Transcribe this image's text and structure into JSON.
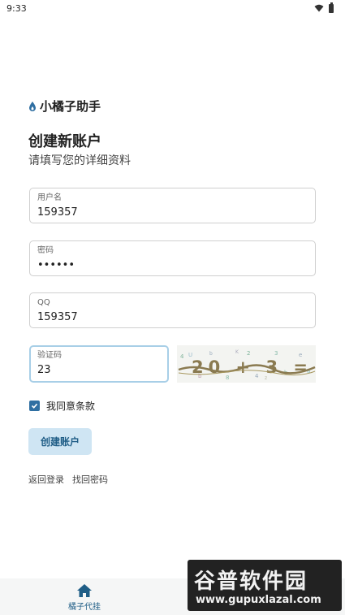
{
  "status_bar": {
    "time": "9:33"
  },
  "brand": {
    "title": "小橘子助手"
  },
  "header": {
    "title": "创建新账户",
    "subtitle": "请填写您的详细资料"
  },
  "form": {
    "username": {
      "label": "用户名",
      "value": "159357"
    },
    "password": {
      "label": "密码",
      "value": "••••••"
    },
    "qq": {
      "label": "QQ",
      "value": "159357"
    },
    "captcha": {
      "label": "验证码",
      "value": "23",
      "image_text": "20 + 3 ="
    },
    "agree_label": "我同意条款",
    "agree_checked": true,
    "submit_label": "创建账户"
  },
  "links": {
    "back_login": "返回登录",
    "find_password": "找回密码"
  },
  "bottom_nav": {
    "items": [
      {
        "label": "橘子代挂",
        "icon": "home-icon"
      }
    ]
  },
  "watermark": {
    "main": "谷普软件园",
    "url": "www.gupuxlazal.com"
  },
  "colors": {
    "accent": "#2f6fa2",
    "button_bg": "#cfe5f3",
    "focus_border": "#a8cfe7"
  }
}
